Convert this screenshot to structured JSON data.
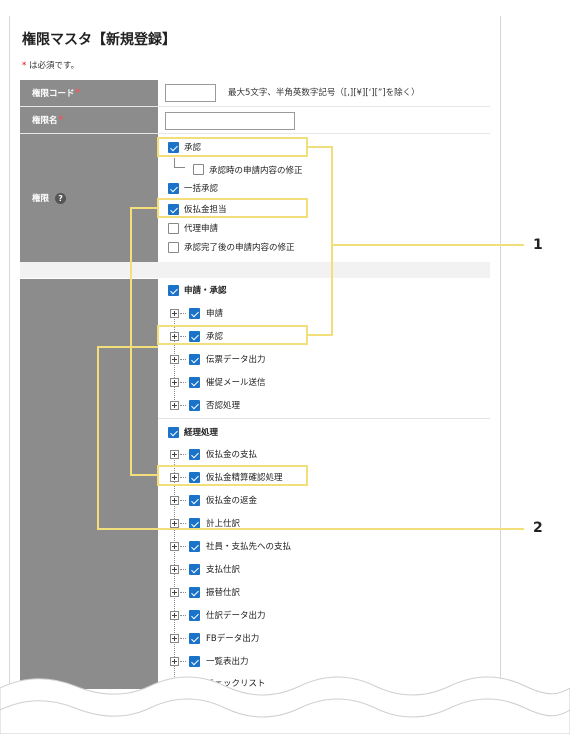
{
  "page": {
    "title": "権限マスタ【新規登録】",
    "required_mark": "*",
    "required_note": " は必須です。"
  },
  "fields": {
    "code": {
      "label": "権限コード",
      "hint": "最大5文字、半角英数字記号（[,][¥][‘][”]を除く）",
      "value": ""
    },
    "name": {
      "label": "権限名",
      "value": ""
    },
    "permission": {
      "label": "権限"
    }
  },
  "permissions": [
    {
      "label": "承認",
      "checked": true
    },
    {
      "label": "承認時の申請内容の修正",
      "checked": false
    },
    {
      "label": "一括承認",
      "checked": true
    },
    {
      "label": "仮払金担当",
      "checked": true
    },
    {
      "label": "代理申請",
      "checked": false
    },
    {
      "label": "承認完了後の申請内容の修正",
      "checked": false
    }
  ],
  "menu_groups": [
    {
      "label": "申請・承認",
      "items": [
        "申請",
        "承認",
        "伝票データ出力",
        "催促メール送信",
        "否認処理"
      ]
    },
    {
      "label": "経理処理",
      "items": [
        "仮払金の支払",
        "仮払金精算確認処理",
        "仮払金の返金",
        "計上仕訳",
        "社員・支払先への支払",
        "支払仕訳",
        "振替仕訳",
        "仕訳データ出力",
        "FBデータ出力",
        "一覧表出力",
        "チェックリスト"
      ]
    }
  ],
  "callouts": [
    "1",
    "2"
  ],
  "colors": {
    "header_bg": "#8c8c8c",
    "checkbox": "#1a73c9",
    "highlight": "#f3df7a",
    "required": "#e00000"
  }
}
